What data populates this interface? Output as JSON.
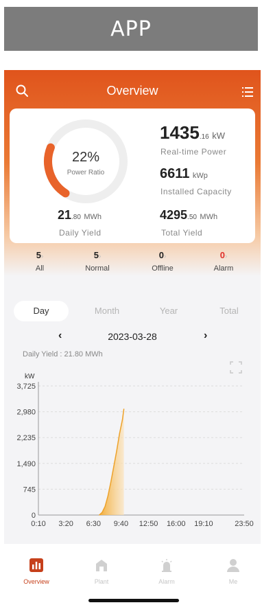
{
  "banner": {
    "label": "APP"
  },
  "header": {
    "title": "Overview"
  },
  "gauge": {
    "percent": "22%",
    "label": "Power Ratio",
    "fraction": 0.22
  },
  "realtime": {
    "value_int": "1435",
    "value_dec": ".16",
    "unit": "kW",
    "label": "Real-time Power"
  },
  "capacity": {
    "value": "6611",
    "unit": "kWp",
    "label": "Installed Capacity"
  },
  "daily": {
    "value_int": "21",
    "value_dec": ".80",
    "unit": "MWh",
    "label": "Daily Yield"
  },
  "total": {
    "value_int": "4295",
    "value_dec": ".50",
    "unit": "MWh",
    "label": "Total Yield"
  },
  "status": [
    {
      "count": "5",
      "label": "All",
      "color": "#222222"
    },
    {
      "count": "5",
      "label": "Normal",
      "color": "#222222"
    },
    {
      "count": "0",
      "label": "Offline",
      "color": "#222222"
    },
    {
      "count": "0",
      "label": "Alarm",
      "color": "#e0302a"
    }
  ],
  "tabs": [
    "Day",
    "Month",
    "Year",
    "Total"
  ],
  "active_tab": "Day",
  "date": "2023-03-28",
  "daily_yield_text": "Daily Yield : 21.80 MWh",
  "nav": [
    {
      "label": "Overview",
      "icon": "chart-bars-icon",
      "active": true
    },
    {
      "label": "Plant",
      "icon": "plant-icon",
      "active": false
    },
    {
      "label": "Alarm",
      "icon": "alarm-icon",
      "active": false
    },
    {
      "label": "Me",
      "icon": "person-icon",
      "active": false
    }
  ],
  "colors": {
    "accent": "#e0541c",
    "area": "#f5b54a",
    "alarm": "#e0302a"
  },
  "chart_data": {
    "type": "area",
    "ylabel": "kW",
    "yticks": [
      "3,725",
      "2,980",
      "2,235",
      "1,490",
      "745",
      "0"
    ],
    "ylim": [
      0,
      3725
    ],
    "xticks": [
      "0:10",
      "3:20",
      "6:30",
      "9:40",
      "12:50",
      "16:00",
      "19:10",
      "23:50"
    ],
    "grid": true,
    "x": [
      "7:10",
      "7:30",
      "7:50",
      "8:10",
      "8:30",
      "8:50",
      "9:10",
      "9:30",
      "9:50",
      "10:00"
    ],
    "values": [
      0,
      80,
      250,
      550,
      950,
      1400,
      1850,
      2350,
      2750,
      3060
    ]
  }
}
